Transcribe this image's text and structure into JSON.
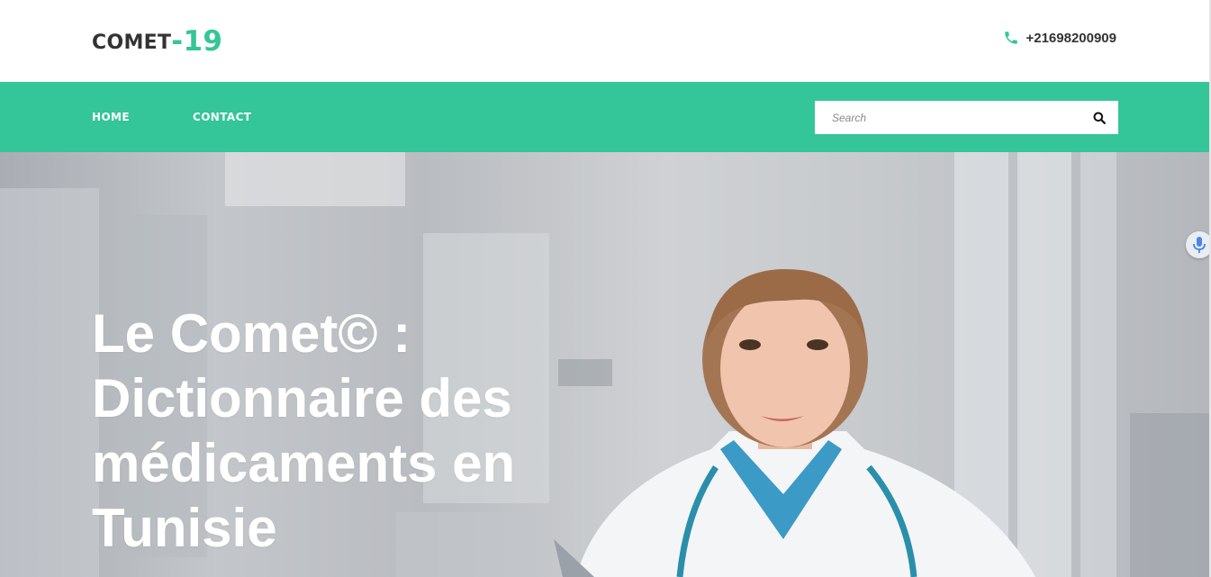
{
  "header": {
    "logo_text": "COMET",
    "logo_number": "-19",
    "phone_icon": "phone-icon",
    "phone_number": "+21698200909"
  },
  "nav": {
    "items": [
      {
        "label": "HOME"
      },
      {
        "label": "CONTACT"
      }
    ],
    "search": {
      "placeholder": "Search",
      "value": "",
      "icon": "search-icon"
    }
  },
  "hero": {
    "title": "Le Comet©  : Dictionnaire des médicaments en Tunisie",
    "image": "doctor-photo",
    "mic_icon": "microphone-icon"
  },
  "colors": {
    "accent": "#34c598",
    "text_dark": "#333333",
    "white": "#ffffff"
  }
}
